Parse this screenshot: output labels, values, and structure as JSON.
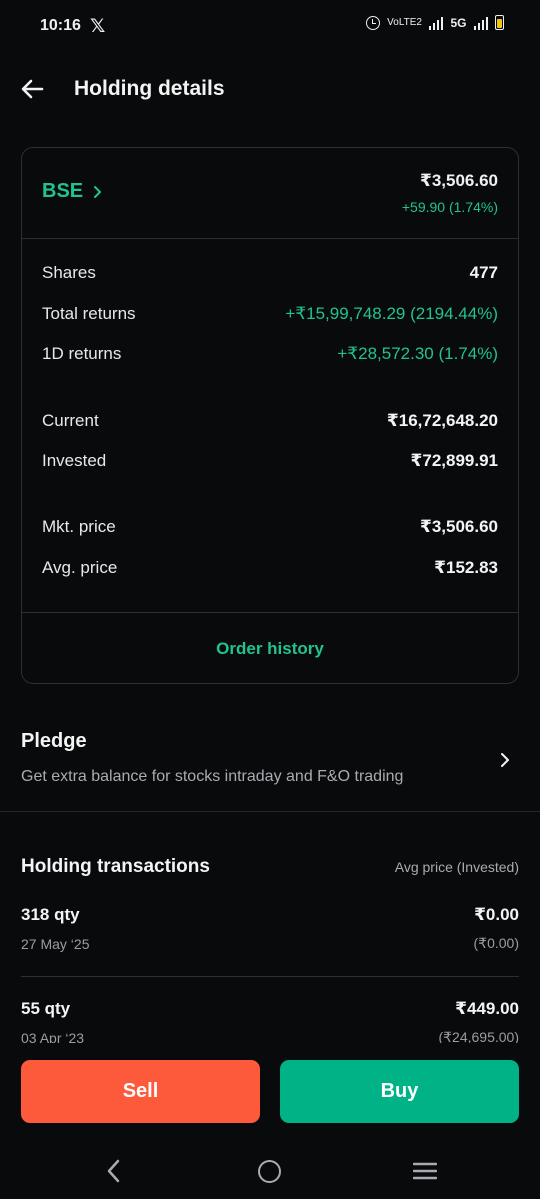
{
  "status_bar": {
    "time": "10:16",
    "notification_icon": "x-logo",
    "volte_label": "VoLTE2",
    "network": "5G",
    "battery_color": "#f5c518"
  },
  "header": {
    "title": "Holding details"
  },
  "holding": {
    "symbol": "BSE",
    "ltp": "₹3,506.60",
    "day_change": "+59.90 (1.74%)",
    "shares_label": "Shares",
    "shares": "477",
    "total_returns_label": "Total returns",
    "total_returns": "+₹15,99,748.29 (2194.44%)",
    "day_returns_label": "1D returns",
    "day_returns": "+₹28,572.30 (1.74%)",
    "current_label": "Current",
    "current": "₹16,72,648.20",
    "invested_label": "Invested",
    "invested": "₹72,899.91",
    "mkt_price_label": "Mkt. price",
    "mkt_price": "₹3,506.60",
    "avg_price_label": "Avg. price",
    "avg_price": "₹152.83",
    "order_history_label": "Order history"
  },
  "pledge": {
    "title": "Pledge",
    "description": "Get extra balance for stocks intraday and F&O trading"
  },
  "transactions": {
    "title": "Holding transactions",
    "subtitle": "Avg price (Invested)",
    "items": [
      {
        "qty": "318 qty",
        "date": "27 May ‘25",
        "price": "₹0.00",
        "invested": "(₹0.00)"
      },
      {
        "qty": "55 qty",
        "date": "03 Apr ‘23",
        "price": "₹449.00",
        "invested": "(₹24,695.00)"
      }
    ]
  },
  "actions": {
    "sell_label": "Sell",
    "buy_label": "Buy"
  },
  "colors": {
    "accent_green": "#22c38e",
    "sell": "#fc5a3a",
    "buy": "#00b386",
    "background": "#080a0c"
  }
}
